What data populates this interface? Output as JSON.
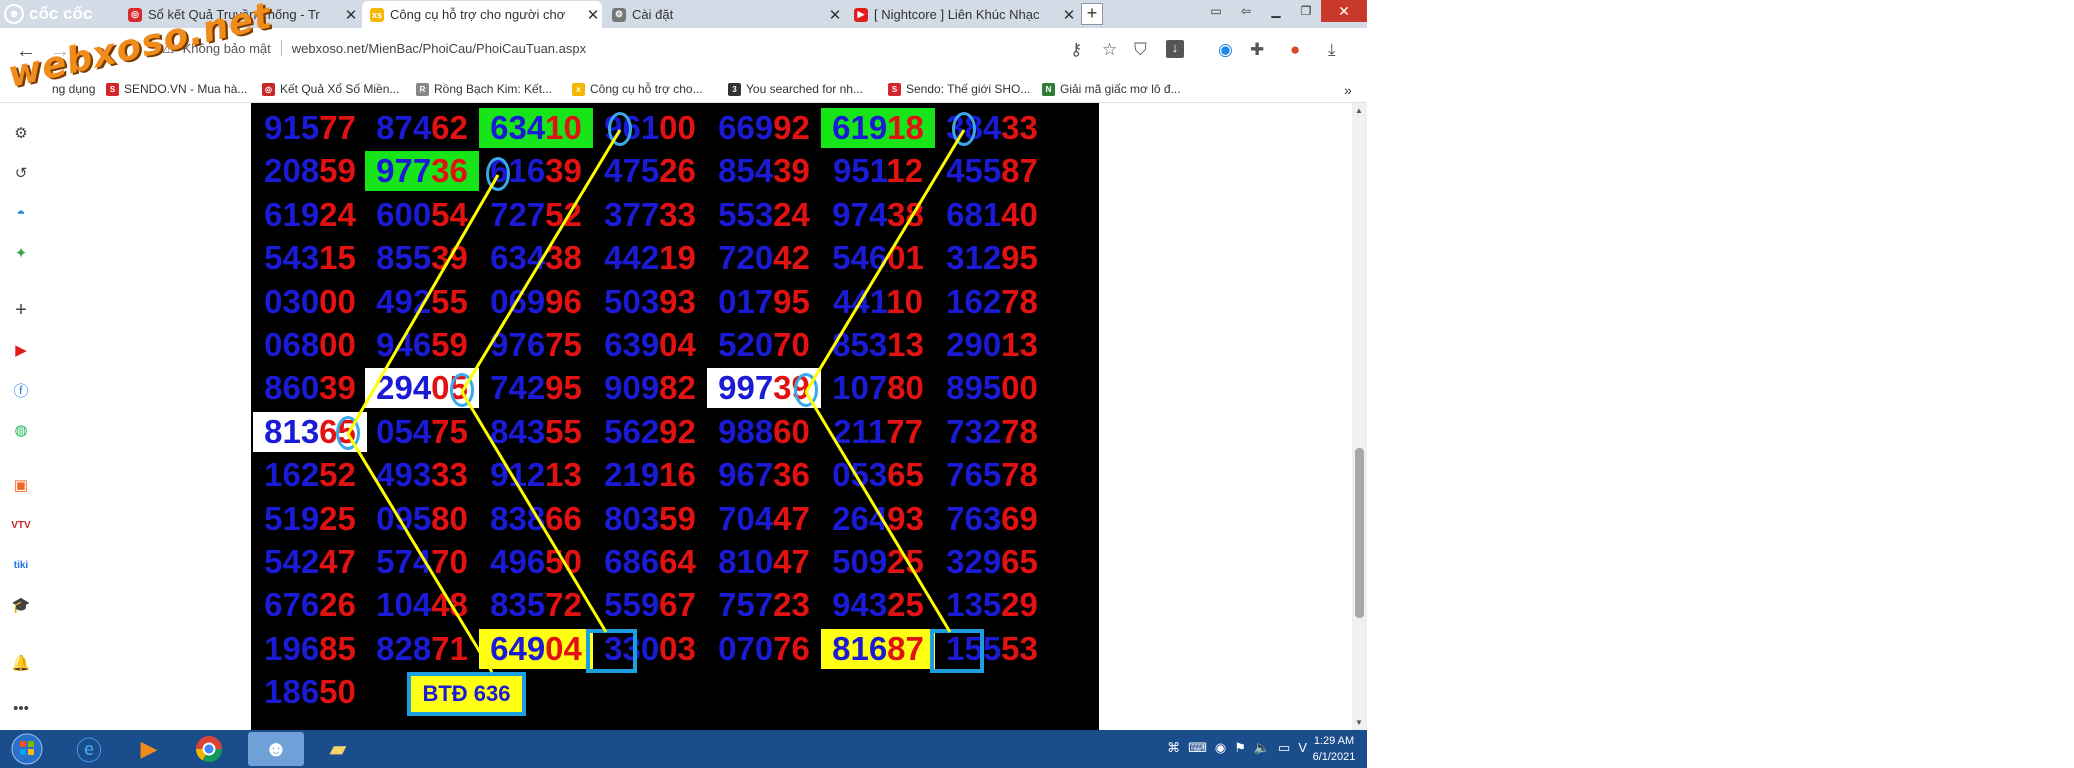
{
  "browser": {
    "brand": "cốc cốc",
    "tabs": [
      {
        "title": "Sổ kết Quả Truyền Thống - Tr",
        "active": false,
        "favicon": "web-icon"
      },
      {
        "title": "Công cụ hỗ trợ cho người chơ",
        "active": true,
        "favicon": "xs-icon"
      },
      {
        "title": "Cài đặt",
        "active": false,
        "favicon": "gear-icon"
      },
      {
        "title": "[ Nightcore ] Liên Khúc Nhạc",
        "active": false,
        "favicon": "youtube-icon"
      }
    ],
    "close_glyph": "✕",
    "new_tab_glyph": "+",
    "security_label": "Không bảo mật",
    "url": "webxoso.net/MienBac/PhoiCau/PhoiCauTuan.aspx"
  },
  "bookmarks": [
    {
      "label": "ng dụng"
    },
    {
      "label": "SENDO.VN - Mua hà..."
    },
    {
      "label": "Kết Quả Xổ Số Miền..."
    },
    {
      "label": "Rồng Bạch Kim: Kết..."
    },
    {
      "label": "Công cụ hỗ trợ cho..."
    },
    {
      "label": "You searched for nh..."
    },
    {
      "label": "Sendo: Thế giới SHO..."
    },
    {
      "label": "Giải mã giấc mơ lô đ..."
    }
  ],
  "watermark": "webxoso.net",
  "board": {
    "rows": [
      [
        "91577",
        "87462",
        "63410",
        "96100",
        "66992",
        "61918",
        "38433"
      ],
      [
        "20859",
        "97736",
        "61639",
        "47526",
        "85439",
        "95112",
        "45587"
      ],
      [
        "61924",
        "60054",
        "72752",
        "37733",
        "55324",
        "97438",
        "68140"
      ],
      [
        "54315",
        "85539",
        "63438",
        "44219",
        "72042",
        "54601",
        "31295"
      ],
      [
        "03000",
        "49255",
        "06996",
        "50393",
        "01795",
        "44110",
        "16278"
      ],
      [
        "06800",
        "94659",
        "97675",
        "63904",
        "52070",
        "85313",
        "29013"
      ],
      [
        "86039",
        "29405",
        "74295",
        "90982",
        "99739",
        "10780",
        "89500"
      ],
      [
        "81365",
        "05475",
        "84355",
        "56292",
        "98860",
        "21177",
        "73278"
      ],
      [
        "16252",
        "49333",
        "91213",
        "21916",
        "96736",
        "05365",
        "76578"
      ],
      [
        "51925",
        "09580",
        "83866",
        "80359",
        "70447",
        "26493",
        "76369"
      ],
      [
        "54247",
        "57470",
        "49650",
        "68664",
        "81047",
        "50925",
        "32965"
      ],
      [
        "67626",
        "10448",
        "83572",
        "55967",
        "75723",
        "94325",
        "13529"
      ],
      [
        "19685",
        "82871",
        "64904",
        "33003",
        "07076",
        "81687",
        "15553"
      ],
      [
        "18650"
      ]
    ],
    "btd_label": "BTĐ 636"
  },
  "taskbar": {
    "time": "1:29 AM",
    "date": "6/1/2021"
  }
}
